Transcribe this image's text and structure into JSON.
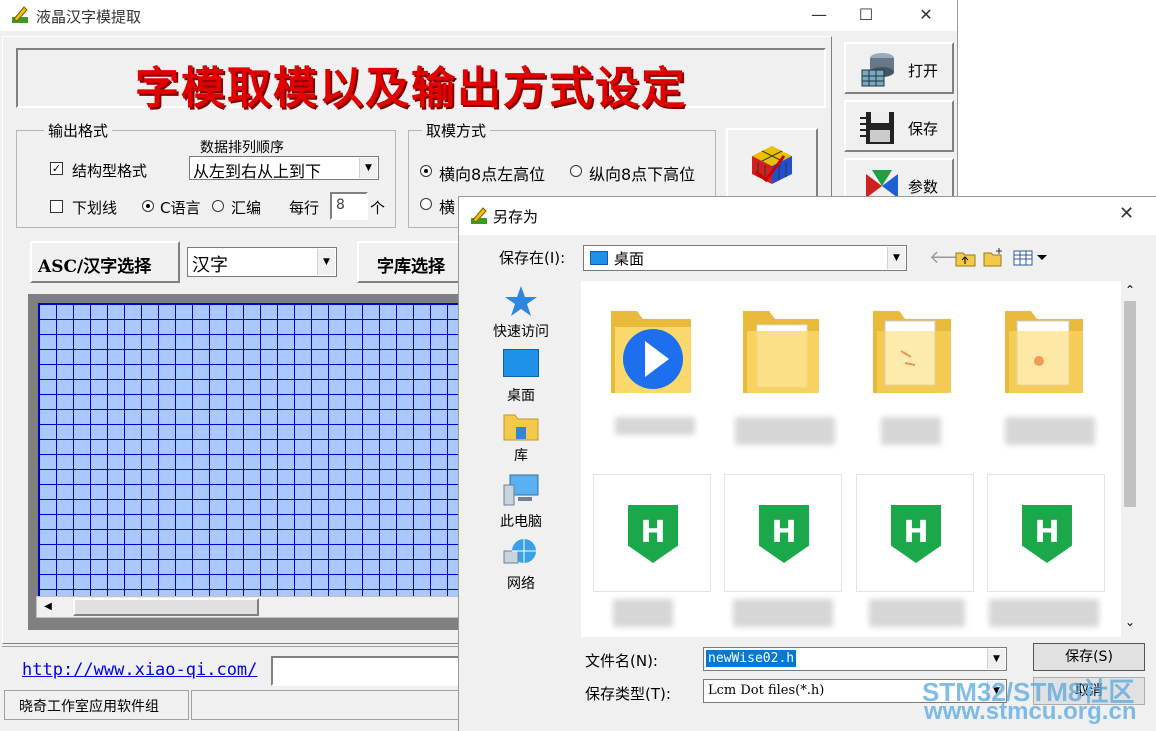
{
  "main_window": {
    "title": "液晶汉字模提取",
    "controls": {
      "minimize": "—",
      "maximize": "☐",
      "close": "✕"
    },
    "banner": "字模取模以及输出方式设定",
    "banner_color": "#e00000",
    "output_format": {
      "group_label": "输出格式",
      "struct_format_label": "结构型格式",
      "struct_format_checked": true,
      "data_order_label": "数据排列顺序",
      "data_order_value": "从左到右从上到下",
      "underline_label": "下划线",
      "underline_checked": false,
      "c_lang_label": "C语言",
      "asm_label": "汇编",
      "per_row_label": "每行",
      "per_row_value": "8",
      "per_row_unit": "个"
    },
    "extract_mode": {
      "group_label": "取模方式",
      "option1": "横向8点左高位",
      "option2": "纵向8点下高位",
      "option3": "横"
    },
    "toolbar": {
      "open": "打开",
      "save": "保存",
      "params": "参数"
    },
    "asc_select_label": "ASC/汉字选择",
    "asc_select_value": "汉字",
    "font_lib_label": "字库选择",
    "url": "http://www.xiao-qi.com/",
    "status_text": "晓奇工作室应用软件组"
  },
  "dialog": {
    "title": "另存为",
    "save_in_label": "保存在(I):",
    "save_in_value": "桌面",
    "places": [
      {
        "label": "快速访问",
        "icon": "star-icon"
      },
      {
        "label": "桌面",
        "icon": "desktop-icon"
      },
      {
        "label": "库",
        "icon": "library-icon"
      },
      {
        "label": "此电脑",
        "icon": "computer-icon"
      },
      {
        "label": "网络",
        "icon": "network-icon"
      }
    ],
    "file_name_label": "文件名(N):",
    "file_name_value": "newWise02.h",
    "file_type_label": "保存类型(T):",
    "file_type_value": "Lcm Dot files(*.h)",
    "save_button": "保存(S)",
    "cancel_button": "取消",
    "h_file_letter": "H"
  },
  "watermark": {
    "line1": "STM32/STM8社区",
    "line2": "www.stmcu.org.cn"
  }
}
